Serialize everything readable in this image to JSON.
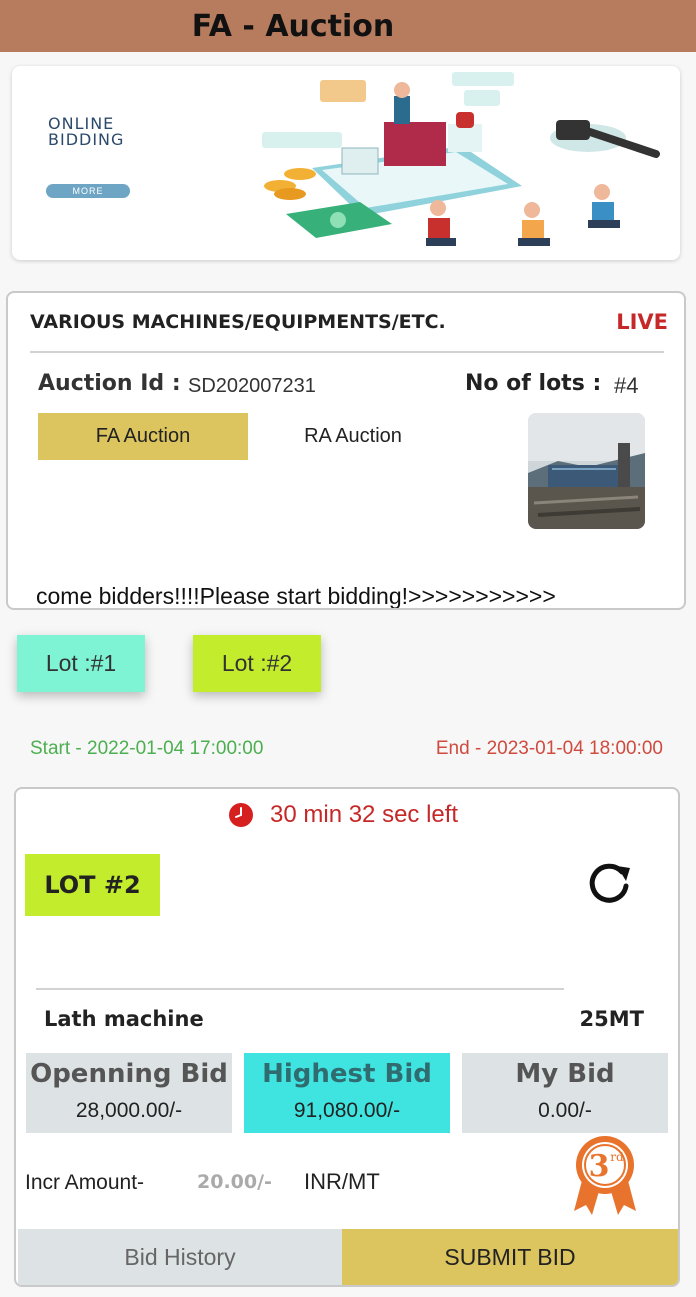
{
  "header": {
    "title": "FA - Auction"
  },
  "banner": {
    "title": "ONLINE\nBIDDING",
    "more_label": "MORE"
  },
  "auction": {
    "title": "VARIOUS MACHINES/EQUIPMENTS/ETC.",
    "status": "LIVE",
    "id_label": "Auction Id :",
    "id_value": "SD202007231",
    "lots_label": "No of lots :",
    "lots_value": "#4",
    "tabs": [
      {
        "label": "FA Auction",
        "active": true
      },
      {
        "label": "RA Auction",
        "active": false
      }
    ],
    "marquee": "come bidders!!!!Please start bidding!>>>>>>>>>>>"
  },
  "lot_tabs": [
    {
      "label": "Lot :#1",
      "color": "#7ef4d4"
    },
    {
      "label": "Lot :#2",
      "color": "#c3ec2c"
    }
  ],
  "schedule": {
    "start": "Start - 2022-01-04 17:00:00",
    "end": "End - 2023-01-04 18:00:00"
  },
  "lot": {
    "timer": "30 min 32 sec left",
    "badge": "LOT #2",
    "item_name": "Lath machine",
    "quantity": "25MT",
    "bids": {
      "opening": {
        "title": "Openning Bid",
        "value": "28,000.00/-"
      },
      "highest": {
        "title": "Highest Bid",
        "value": "91,080.00/-"
      },
      "mine": {
        "title": "My Bid",
        "value": "0.00/-"
      }
    },
    "incr_label": "Incr Amount-",
    "incr_value": "20.00/-",
    "incr_unit": "INR/MT",
    "rank": "3rd",
    "buttons": {
      "history": "Bid History",
      "submit": "SUBMIT BID"
    }
  },
  "colors": {
    "header": "#b77b5e",
    "gold": "#dcc45f",
    "live": "#c62828",
    "lime": "#c3ec2c",
    "mint": "#7ef4d4",
    "cyan": "#3fe4e0"
  }
}
